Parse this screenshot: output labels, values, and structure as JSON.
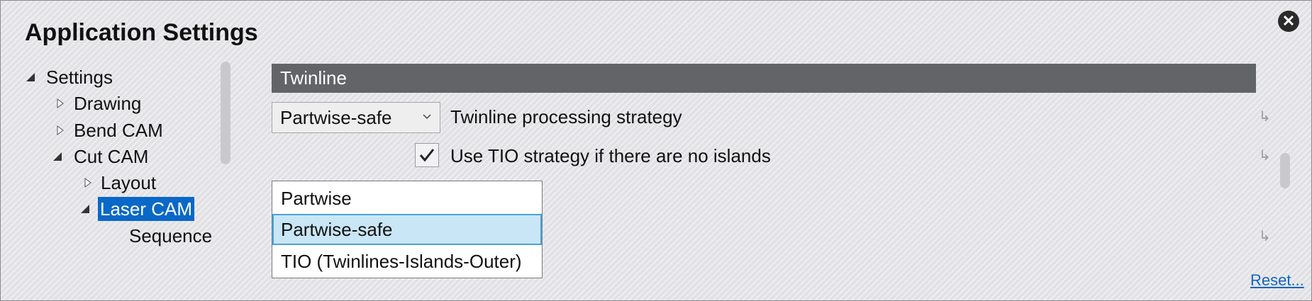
{
  "window": {
    "title": "Application Settings",
    "close_icon": "close-icon"
  },
  "tree": {
    "items": [
      {
        "label": "Settings",
        "state": "expanded"
      },
      {
        "label": "Drawing",
        "state": "collapsed"
      },
      {
        "label": "Bend CAM",
        "state": "collapsed"
      },
      {
        "label": "Cut CAM",
        "state": "expanded"
      },
      {
        "label": "Layout",
        "state": "collapsed"
      },
      {
        "label": "Laser CAM",
        "state": "expanded",
        "selected": true
      },
      {
        "label": "Sequence",
        "state": "leaf"
      }
    ]
  },
  "section": {
    "header": "Twinline",
    "strategy_combo_value": "Partwise-safe",
    "strategy_label": "Twinline processing strategy",
    "tio_checkbox_checked": true,
    "tio_checkbox_label": "Use TIO strategy if there are no islands"
  },
  "dropdown": {
    "options": [
      "Partwise",
      "Partwise-safe",
      "TIO (Twinlines-Islands-Outer)"
    ],
    "highlighted": "Partwise-safe"
  },
  "footer": {
    "reset_label": "Reset..."
  },
  "icons": {
    "checkmark": "✓",
    "reset_arrow": "↳",
    "chevron": "⌄"
  }
}
